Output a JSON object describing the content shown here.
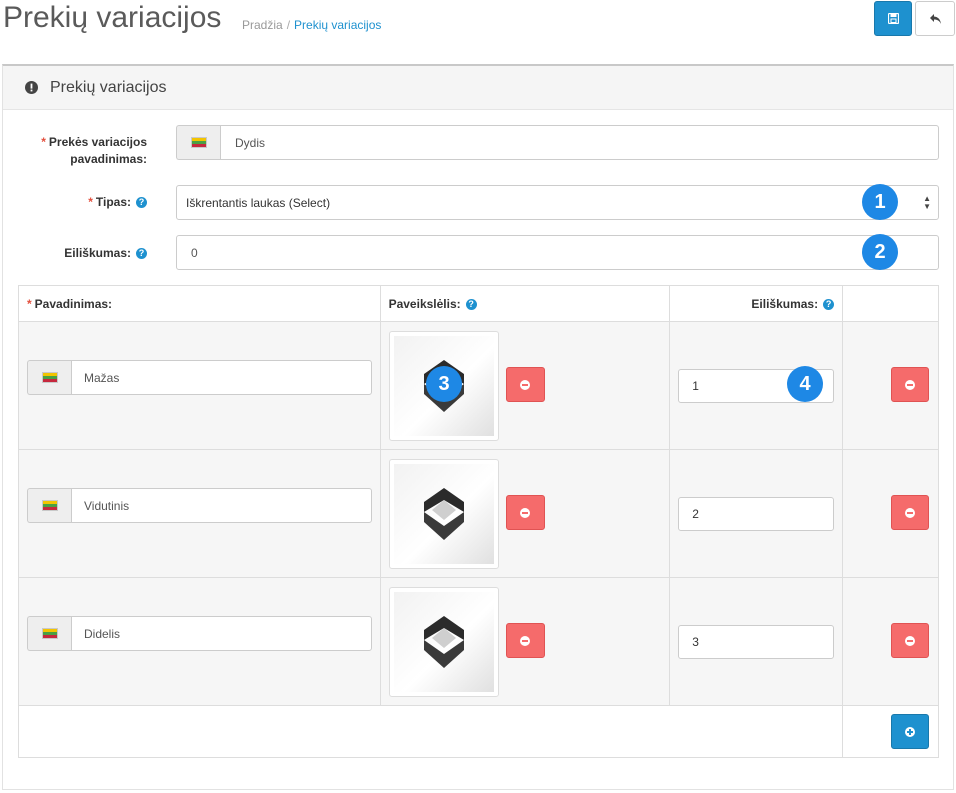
{
  "header": {
    "title": "Prekių variacijos",
    "breadcrumb": [
      "Pradžia",
      "Prekių variacijos"
    ],
    "breadcrumb_separator": "/"
  },
  "panel": {
    "title": "Prekių variacijos"
  },
  "form": {
    "name_label_line1": "Prekės variacijos",
    "name_label_line2": "pavadinimas:",
    "name_value": "Dydis",
    "type_label": "Tipas:",
    "type_value": "Iškrentantis laukas (Select)",
    "sort_label": "Eiliškumas:",
    "sort_value": "0",
    "required_mark": "*",
    "help_mark": "?"
  },
  "table": {
    "col_name": "Pavadinimas:",
    "col_image": "Paveikslėlis:",
    "col_sort": "Eiliškumas:",
    "rows": [
      {
        "name": "Mažas",
        "sort": "1"
      },
      {
        "name": "Vidutinis",
        "sort": "2"
      },
      {
        "name": "Didelis",
        "sort": "3"
      }
    ]
  },
  "markers": [
    "1",
    "2",
    "3",
    "4"
  ],
  "colors": {
    "primary": "#1e91cf",
    "danger": "#f56b6b",
    "marker": "#1e88e5",
    "required": "#e3503e"
  },
  "icons": {
    "save": "floppy-disk-icon",
    "back": "reply-arrow-icon",
    "panel": "exclamation-circle-icon",
    "remove": "minus-circle-icon",
    "add": "plus-circle-icon",
    "flag": "lithuania-flag-icon"
  }
}
